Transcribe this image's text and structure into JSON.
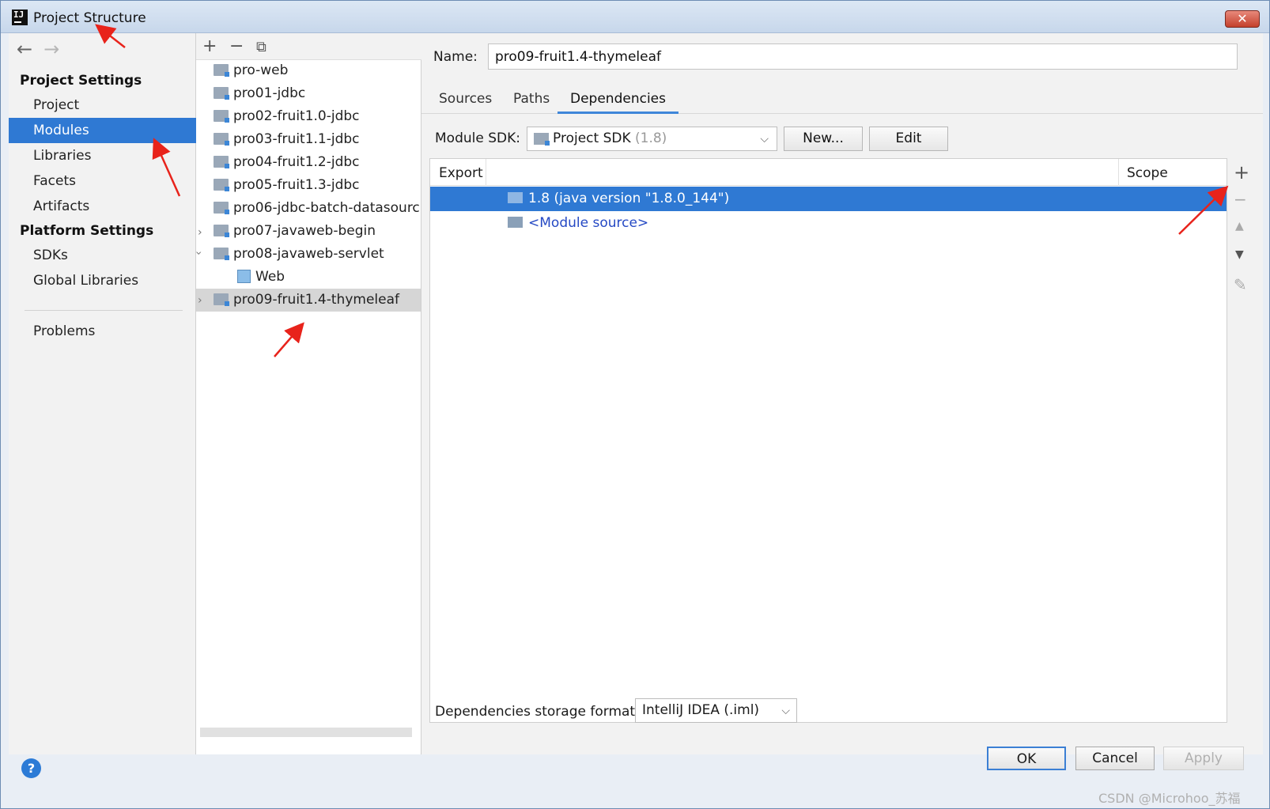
{
  "window": {
    "title": "Project Structure",
    "app_icon": "IJ",
    "close_label": "✕"
  },
  "nav": {
    "back_icon": "←",
    "forward_icon": "→",
    "project_settings_header": "Project Settings",
    "project_settings_items": [
      "Project",
      "Modules",
      "Libraries",
      "Facets",
      "Artifacts"
    ],
    "platform_settings_header": "Platform Settings",
    "platform_settings_items": [
      "SDKs",
      "Global Libraries"
    ],
    "problems": "Problems",
    "selected": "Modules"
  },
  "tree": {
    "toolbar": {
      "add": "+",
      "remove": "−",
      "copy": "⧉"
    },
    "items": [
      "pro-web",
      "pro01-jdbc",
      "pro02-fruit1.0-jdbc",
      "pro03-fruit1.1-jdbc",
      "pro04-fruit1.2-jdbc",
      "pro05-fruit1.3-jdbc",
      "pro06-jdbc-batch-datasourc",
      "pro07-javaweb-begin",
      "pro08-javaweb-servlet",
      "Web",
      "pro09-fruit1.4-thymeleaf"
    ],
    "selected": "pro09-fruit1.4-thymeleaf"
  },
  "module": {
    "name_label": "Name:",
    "name_value": "pro09-fruit1.4-thymeleaf",
    "tabs": [
      "Sources",
      "Paths",
      "Dependencies"
    ],
    "active_tab": "Dependencies",
    "sdk_label": "Module SDK:",
    "sdk_value": "Project SDK",
    "sdk_version": "(1.8)",
    "new_button": "New...",
    "edit_button": "Edit",
    "deps_header_export": "Export",
    "deps_header_scope": "Scope",
    "dependencies": [
      "1.8 (java version \"1.8.0_144\")",
      "<Module source>"
    ],
    "side_tools": {
      "add": "+",
      "remove": "−",
      "up": "▲",
      "down": "▼",
      "edit": "✎"
    },
    "storage_label": "Dependencies storage format:",
    "storage_value": "IntelliJ IDEA (.iml)"
  },
  "footer": {
    "help": "?",
    "ok": "OK",
    "cancel": "Cancel",
    "apply": "Apply"
  },
  "watermark": "CSDN @Microhoo_苏福",
  "colors": {
    "selection": "#2f79d3",
    "accent": "#3f86d9",
    "annotation": "#e8231b"
  }
}
